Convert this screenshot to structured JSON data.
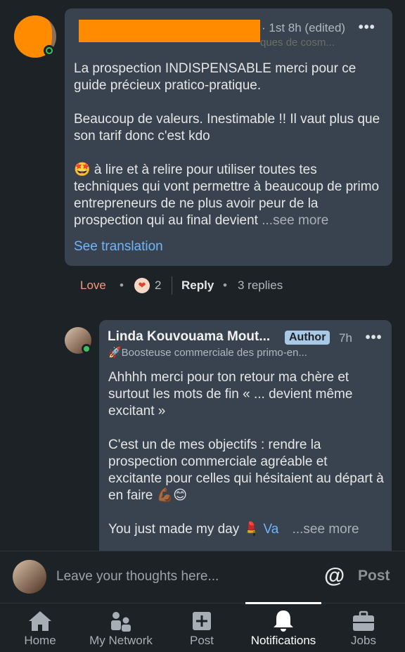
{
  "comment1": {
    "meta": "· 1st 8h (edited)",
    "more": "•••",
    "headline_visible": "ques de cosm...",
    "paragraph1": "La prospection INDISPENSABLE merci pour ce guide précieux pratico-pratique.",
    "paragraph2": "Beaucoup de valeurs. Inestimable !! Il vaut plus que son tarif donc c'est kdo",
    "paragraph3": "🤩 à lire et à relire pour utiliser toutes tes techniques qui vont permettre à beaucoup de primo entrepreneurs de ne plus avoir peur de la prospection qui au final devient",
    "see_more": "...see more",
    "see_translation": "See translation",
    "reaction": "Love",
    "reaction_icon": "heart-icon",
    "reaction_count": "2",
    "reply": "Reply",
    "replies": "3 replies"
  },
  "comment2": {
    "name": "Linda Kouvouama Mout...",
    "badge": "Author",
    "time": "7h",
    "more": "•••",
    "headline": "🚀Boosteuse commerciale des primo-en...",
    "paragraph1": "Ahhhh merci pour ton retour ma chère et surtout les mots de fin « ... devient même excitant »",
    "paragraph2": "C'est un de mes objectifs : rendre la prospection commerciale agréable et excitante pour celles qui hésitaient au départ à en faire 💪🏾😊",
    "paragraph3_prefix": "You just made my day 💄 ",
    "paragraph3_link": "Va",
    "see_more": "...see more"
  },
  "compose": {
    "placeholder": "Leave your thoughts here...",
    "mention": "@",
    "post": "Post"
  },
  "tabs": [
    {
      "label": "Home",
      "icon": "home-icon"
    },
    {
      "label": "My Network",
      "icon": "network-icon"
    },
    {
      "label": "Post",
      "icon": "post-icon"
    },
    {
      "label": "Notifications",
      "icon": "bell-icon",
      "active": true
    },
    {
      "label": "Jobs",
      "icon": "briefcase-icon"
    }
  ],
  "colors": {
    "background": "#1d2226",
    "bubble": "#38434f",
    "link": "#70b5f9",
    "love": "#f5987e",
    "online": "#3fbf5f",
    "redaction": "#ff8c00"
  }
}
